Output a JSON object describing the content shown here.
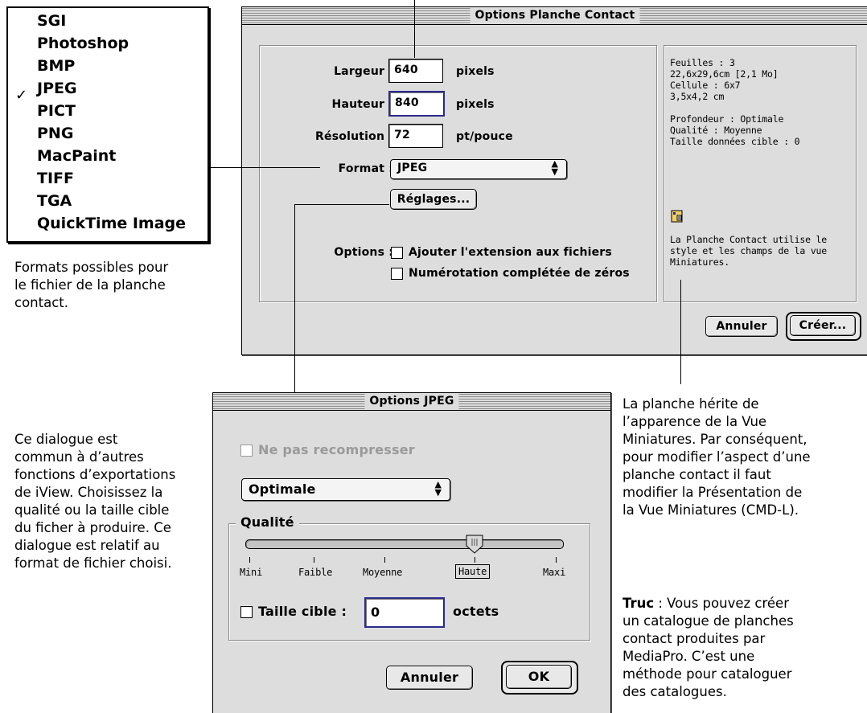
{
  "format_menu": {
    "items": [
      "SGI",
      "Photoshop",
      "BMP",
      "JPEG",
      "PICT",
      "PNG",
      "MacPaint",
      "TIFF",
      "TGA",
      "QuickTime Image"
    ],
    "checked": "JPEG",
    "check_glyph": "✓"
  },
  "caption_formats": [
    "Formats possibles pour",
    "le fichier de la planche",
    "contact."
  ],
  "contact_sheet_dialog": {
    "title": "Options Planche Contact",
    "width_label": "Largeur :",
    "width_value": "640",
    "width_unit": "pixels",
    "height_label": "Hauteur :",
    "height_value": "840",
    "height_unit": "pixels",
    "resolution_label": "Résolution :",
    "resolution_value": "72",
    "resolution_unit": "pt/pouce",
    "format_label": "Format :",
    "format_value": "JPEG",
    "settings_button": "Réglages...",
    "options_label": "Options :",
    "option_extension": "Ajouter l'extension aux fichiers",
    "option_zero_padding": "Numérotation complétée de zéros",
    "info": {
      "sheets": "Feuilles : 3",
      "sheet_size": "22,6x29,6cm [2,1 Mo]",
      "cell": "Cellule : 6x7",
      "cell_size": "3,5x4,2 cm",
      "depth": "Profondeur : Optimale",
      "quality": "Qualité : Moyenne",
      "target_size": "Taille données cible : 0",
      "note_lines": [
        "La Planche Contact utilise le",
        "style et les champs de la vue",
        "Miniatures."
      ],
      "note_icon": "info-document-icon"
    },
    "cancel_button": "Annuler",
    "create_button": "Créer..."
  },
  "jpeg_dialog": {
    "title": "Options JPEG",
    "no_recompress_label": "Ne pas recompresser",
    "mode_value": "Optimale",
    "quality_group_label": "Qualité",
    "slider_ticks": [
      "Mini",
      "Faible",
      "Moyenne",
      "Haute",
      "Maxi"
    ],
    "slider_selected": "Haute",
    "slider_level": 0.75,
    "target_size_label": "Taille cible :",
    "target_size_value": "0",
    "target_size_unit": "octets",
    "cancel_button": "Annuler",
    "ok_button": "OK"
  },
  "caption_dialog": [
    "Ce dialogue est",
    "commun à d’autres",
    "fonctions d’exportations",
    "de iView. Choisissez la",
    "qualité ou la taille cible",
    "du ficher à produire. Ce",
    "dialogue est relatif au",
    "format de fichier choisi."
  ],
  "caption_inherit": [
    "La planche hérite de",
    "l’apparence de la Vue",
    "Miniatures. Par conséquent,",
    "pour modifier l’aspect d’une",
    "planche contact il faut",
    "modifier la Présentation de",
    "la Vue Miniatures (CMD-L)."
  ],
  "caption_tip": {
    "bold": "Truc",
    "lines": [
      " : Vous pouvez créer",
      "un catalogue de planches",
      "contact produites par",
      "MediaPro. C’est une",
      "méthode pour cataloguer",
      "des catalogues."
    ]
  }
}
